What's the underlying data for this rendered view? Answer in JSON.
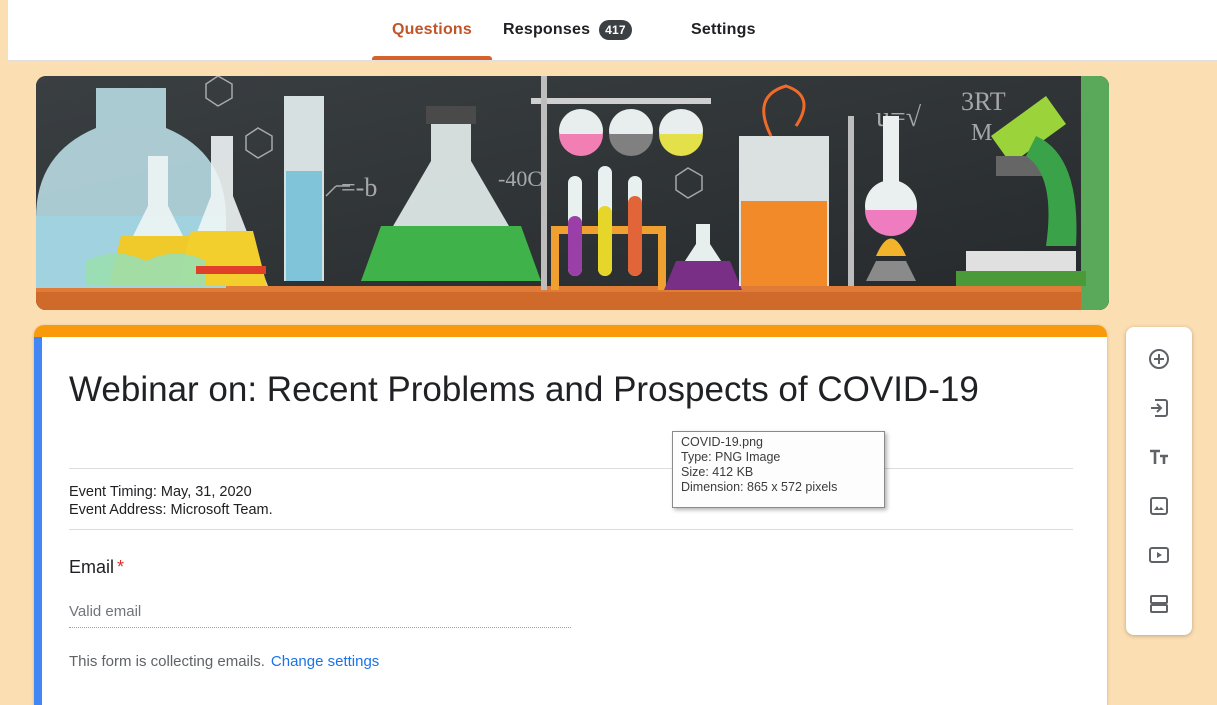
{
  "tabs": {
    "questions": "Questions",
    "responses": "Responses",
    "responses_count": "417",
    "settings": "Settings"
  },
  "form": {
    "title": "Webinar on: Recent Problems and Prospects of COVID-19",
    "description_line1": "Event Timing: May, 31, 2020",
    "description_line2": "Event Address: Microsoft Team.",
    "email_label": "Email",
    "required_mark": "*",
    "email_placeholder": "Valid email",
    "collecting_note": "This form is collecting emails.",
    "change_settings_link": "Change settings"
  },
  "tooltip": {
    "line1": "COVID-19.png",
    "line2": "Type: PNG Image",
    "line3": "Size: 412 KB",
    "line4": "Dimension: 865 x 572 pixels"
  },
  "toolbar": {
    "icons": [
      "add-question-icon",
      "import-questions-icon",
      "add-title-icon",
      "add-image-icon",
      "add-video-icon",
      "add-section-icon"
    ]
  },
  "colors": {
    "theme_background": "#fbdeb2",
    "accent_orange": "#f99a0a",
    "tab_active": "#d7612a",
    "left_bar_blue": "#4285f4",
    "link_blue": "#1a73e8"
  }
}
